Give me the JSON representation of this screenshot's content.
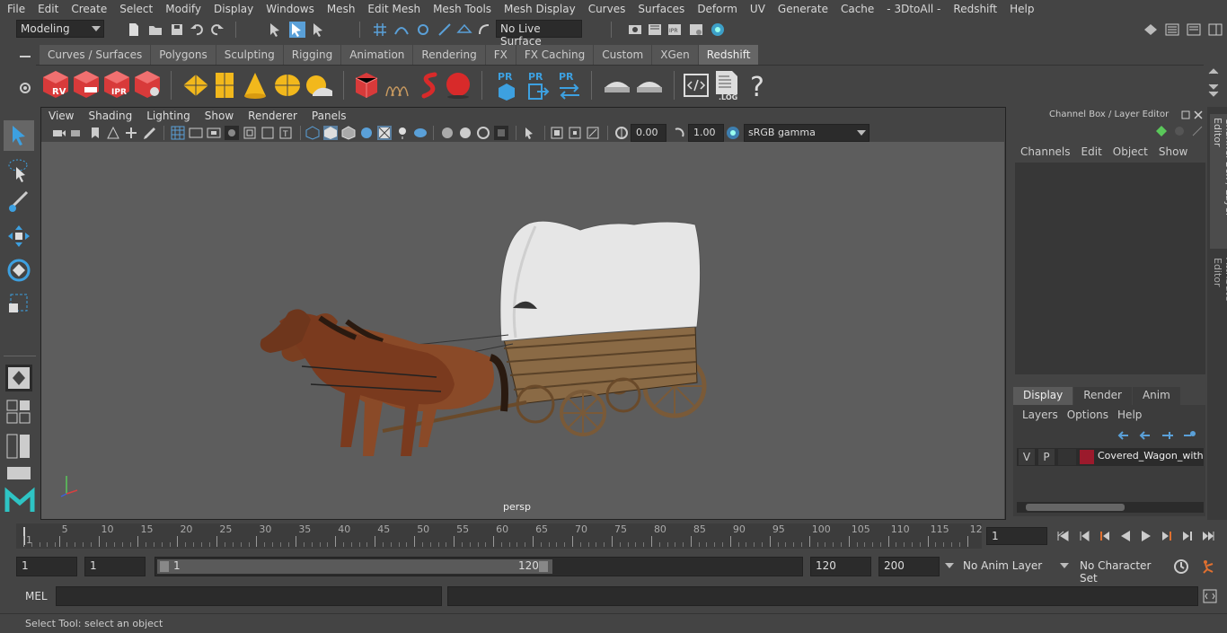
{
  "menubar": [
    "File",
    "Edit",
    "Create",
    "Select",
    "Modify",
    "Display",
    "Windows",
    "Mesh",
    "Edit Mesh",
    "Mesh Tools",
    "Mesh Display",
    "Curves",
    "Surfaces",
    "Deform",
    "UV",
    "Generate",
    "Cache",
    "- 3DtoAll -",
    "Redshift",
    "Help"
  ],
  "statusline": {
    "mode": "Modeling",
    "live_surface": "No Live Surface"
  },
  "shelf_tabs": [
    "Curves / Surfaces",
    "Polygons",
    "Sculpting",
    "Rigging",
    "Animation",
    "Rendering",
    "FX",
    "FX Caching",
    "Custom",
    "XGen",
    "Redshift"
  ],
  "shelf_active": "Redshift",
  "shelf_icons": {
    "rv": "RV",
    "ipr": "IPR",
    "pr": "PR",
    "log": ".LOG",
    "help": "?"
  },
  "viewport": {
    "menu": [
      "View",
      "Shading",
      "Lighting",
      "Show",
      "Renderer",
      "Panels"
    ],
    "exposure": "0.00",
    "gamma": "1.00",
    "color_space": "sRGB gamma",
    "camera_label": "persp"
  },
  "channel_box": {
    "title": "Channel Box / Layer Editor",
    "menu": [
      "Channels",
      "Edit",
      "Object",
      "Show"
    ]
  },
  "layer_editor": {
    "tabs": [
      "Display",
      "Render",
      "Anim"
    ],
    "active_tab": "Display",
    "menu": [
      "Layers",
      "Options",
      "Help"
    ],
    "layer": {
      "v": "V",
      "p": "P",
      "color": "#9b1a2c",
      "name": "Covered_Wagon_with"
    }
  },
  "side_tabs": [
    "Channel Box / Layer Editor",
    "Attribute Editor"
  ],
  "timeline": {
    "ticks": [
      "1",
      "5",
      "10",
      "15",
      "20",
      "25",
      "30",
      "35",
      "40",
      "45",
      "50",
      "55",
      "60",
      "65",
      "70",
      "75",
      "80",
      "85",
      "90",
      "95",
      "100",
      "105",
      "110",
      "115",
      "12"
    ],
    "current_frame": "1"
  },
  "range": {
    "start": "1",
    "playback_start": "1",
    "slider_start": "1",
    "slider_end": "120",
    "end": "120",
    "anim_end": "200",
    "anim_layer": "No Anim Layer",
    "character_set": "No Character Set"
  },
  "cmdline": {
    "lang": "MEL"
  },
  "helpline": {
    "text": "Select Tool: select an object"
  },
  "colors": {
    "accent": "#5aa0d8",
    "viewport_bg": "#5d5d5d",
    "redshift_red": "#d83a3a"
  }
}
